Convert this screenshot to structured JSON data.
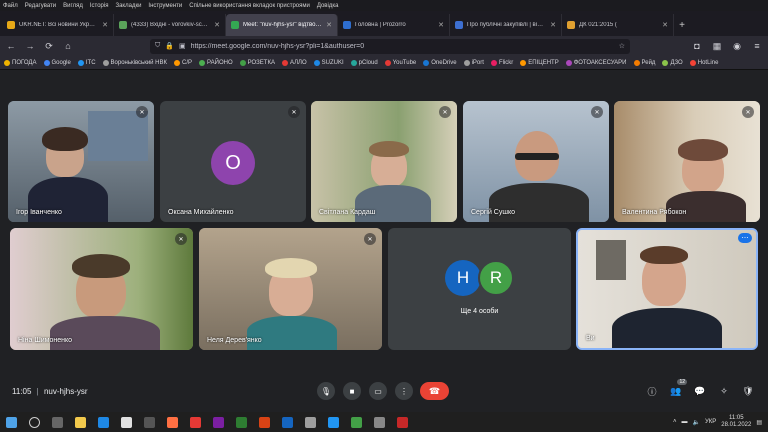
{
  "menu": [
    "Файл",
    "Редагувати",
    "Вигляд",
    "Історія",
    "Закладки",
    "Інструменти",
    "Спільне використання вкладок пристроями",
    "Довідка"
  ],
  "tabs": [
    {
      "label": "UKR.NET: Всі новини України",
      "color": "#e6a817"
    },
    {
      "label": "(4333) Вхідні - vorovkiv-school",
      "color": "#5aa25a"
    },
    {
      "label": "Meet: \"nuv-hjhs-ysr\" відтворення",
      "color": "#34a853",
      "active": true
    },
    {
      "label": "Головна | Prozorro",
      "color": "#2e6ecf"
    },
    {
      "label": "Про публічні закупівлі | від 25",
      "color": "#3d6fd1"
    },
    {
      "label": "ДК 021:2015 (",
      "color": "#e0a030"
    }
  ],
  "address": {
    "url": "https://meet.google.com/nuv-hjhs-ysr?pli=1&authuser=0"
  },
  "bookmarks": [
    {
      "label": "ПОГОДА",
      "color": "#f0b400"
    },
    {
      "label": "Google",
      "color": "#4285f4"
    },
    {
      "label": "ITC",
      "color": "#2196f3"
    },
    {
      "label": "Вороньківський НВК",
      "color": "#9e9e9e"
    },
    {
      "label": "С/Р",
      "color": "#ff9800"
    },
    {
      "label": "РАЙОНО",
      "color": "#4caf50"
    },
    {
      "label": "РОЗЕТКА",
      "color": "#43a047"
    },
    {
      "label": "АЛЛО",
      "color": "#e53935"
    },
    {
      "label": "SUZUKI",
      "color": "#1e88e5"
    },
    {
      "label": "pCloud",
      "color": "#26a69a"
    },
    {
      "label": "YouTube",
      "color": "#e53935"
    },
    {
      "label": "OneDrive",
      "color": "#1976d2"
    },
    {
      "label": "iPort",
      "color": "#9e9e9e"
    },
    {
      "label": "Flickr",
      "color": "#e91e63"
    },
    {
      "label": "ЕПІЦЕНТР",
      "color": "#ff9800"
    },
    {
      "label": "ФОТОАКСЕСУАРИ",
      "color": "#ab47bc"
    },
    {
      "label": "Рейд",
      "color": "#f57c00"
    },
    {
      "label": "ДЗО",
      "color": "#8bc34a"
    },
    {
      "label": "HotLine",
      "color": "#f44336"
    }
  ],
  "participants": [
    {
      "name": "Ігор Іванченко"
    },
    {
      "name": "Оксана Михайленко",
      "initial": "О",
      "avatar_color": "#8e44ad"
    },
    {
      "name": "Світлана Кардаш"
    },
    {
      "name": "Сергій Сушко"
    },
    {
      "name": "Валентина Рябокон"
    },
    {
      "name": "Ніна Шимоненко"
    },
    {
      "name": "Неля Дерев'янко"
    },
    {
      "name": "Ви"
    }
  ],
  "others": {
    "label": "Ще 4 особи",
    "h_initial": "H",
    "h_color": "#1565c0",
    "r_initial": "R",
    "r_color": "#43a047"
  },
  "meeting": {
    "time": "11:05",
    "code": "nuv-hjhs-ysr",
    "people_count": "12"
  },
  "tray": {
    "lang": "УКР",
    "time": "11:05",
    "date": "28.01.2022"
  }
}
